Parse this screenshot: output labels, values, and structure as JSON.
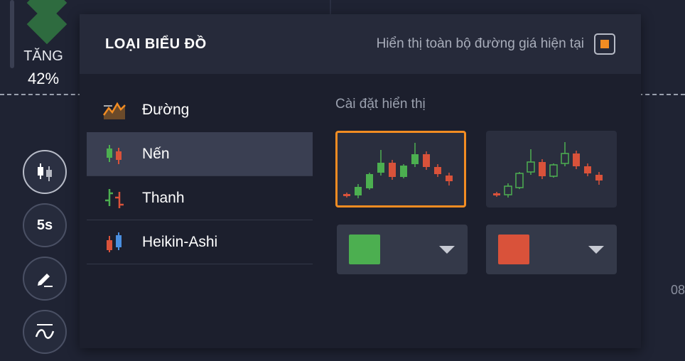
{
  "background": {
    "up_label": "TĂNG",
    "up_percent": "42%",
    "edge_text": "08"
  },
  "toolbar": {
    "candle_btn_icon": "candlestick-icon",
    "interval_label": "5s",
    "draw_btn_icon": "pencil-icon",
    "indicator_btn_icon": "indicator-wave-icon"
  },
  "panel": {
    "title": "LOẠI BIỂU ĐỒ",
    "show_full_price_line_label": "Hiển thị toàn bộ đường giá hiện tại",
    "show_full_price_line_checked": true,
    "chart_types": [
      {
        "label": "Đường",
        "icon": "line-chart-icon",
        "selected": false
      },
      {
        "label": "Nến",
        "icon": "candlestick-icon",
        "selected": true
      },
      {
        "label": "Thanh",
        "icon": "bar-chart-icon",
        "selected": false
      },
      {
        "label": "Heikin-Ashi",
        "icon": "heikin-ashi-icon",
        "selected": false
      }
    ],
    "settings_title": "Cài đặt hiển thị",
    "styles": [
      {
        "name": "filled-candles",
        "selected": true
      },
      {
        "name": "hollow-candles",
        "selected": false
      }
    ],
    "colors": {
      "up": "#4caf50",
      "down": "#d9523a",
      "accent": "#f28c22"
    }
  }
}
